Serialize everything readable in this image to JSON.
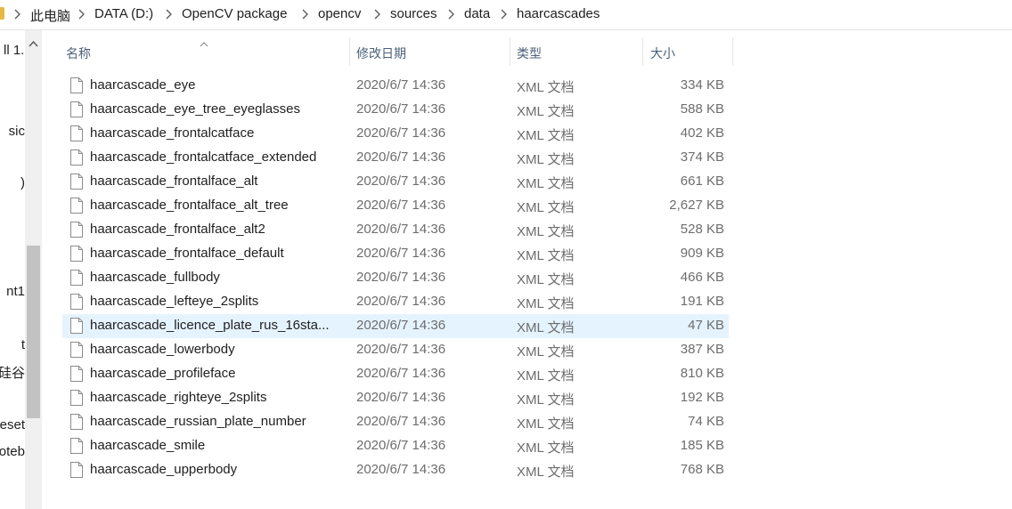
{
  "breadcrumb": [
    "此电脑",
    "DATA (D:)",
    "OpenCV package",
    "opencv",
    "sources",
    "data",
    "haarcascades"
  ],
  "nav_pane_fragments": [
    "ll 1.",
    "sic",
    ")",
    "nt1",
    "t",
    "硅谷",
    "eset",
    "oteb"
  ],
  "columns": {
    "name": "名称",
    "date": "修改日期",
    "type": "类型",
    "size": "大小"
  },
  "files": [
    {
      "name": "haarcascade_eye",
      "date": "2020/6/7 14:36",
      "type": "XML 文档",
      "size": "334 KB"
    },
    {
      "name": "haarcascade_eye_tree_eyeglasses",
      "date": "2020/6/7 14:36",
      "type": "XML 文档",
      "size": "588 KB"
    },
    {
      "name": "haarcascade_frontalcatface",
      "date": "2020/6/7 14:36",
      "type": "XML 文档",
      "size": "402 KB"
    },
    {
      "name": "haarcascade_frontalcatface_extended",
      "date": "2020/6/7 14:36",
      "type": "XML 文档",
      "size": "374 KB"
    },
    {
      "name": "haarcascade_frontalface_alt",
      "date": "2020/6/7 14:36",
      "type": "XML 文档",
      "size": "661 KB"
    },
    {
      "name": "haarcascade_frontalface_alt_tree",
      "date": "2020/6/7 14:36",
      "type": "XML 文档",
      "size": "2,627 KB"
    },
    {
      "name": "haarcascade_frontalface_alt2",
      "date": "2020/6/7 14:36",
      "type": "XML 文档",
      "size": "528 KB"
    },
    {
      "name": "haarcascade_frontalface_default",
      "date": "2020/6/7 14:36",
      "type": "XML 文档",
      "size": "909 KB"
    },
    {
      "name": "haarcascade_fullbody",
      "date": "2020/6/7 14:36",
      "type": "XML 文档",
      "size": "466 KB"
    },
    {
      "name": "haarcascade_lefteye_2splits",
      "date": "2020/6/7 14:36",
      "type": "XML 文档",
      "size": "191 KB"
    },
    {
      "name": "haarcascade_licence_plate_rus_16sta...",
      "date": "2020/6/7 14:36",
      "type": "XML 文档",
      "size": "47 KB"
    },
    {
      "name": "haarcascade_lowerbody",
      "date": "2020/6/7 14:36",
      "type": "XML 文档",
      "size": "387 KB"
    },
    {
      "name": "haarcascade_profileface",
      "date": "2020/6/7 14:36",
      "type": "XML 文档",
      "size": "810 KB"
    },
    {
      "name": "haarcascade_righteye_2splits",
      "date": "2020/6/7 14:36",
      "type": "XML 文档",
      "size": "192 KB"
    },
    {
      "name": "haarcascade_russian_plate_number",
      "date": "2020/6/7 14:36",
      "type": "XML 文档",
      "size": "74 KB"
    },
    {
      "name": "haarcascade_smile",
      "date": "2020/6/7 14:36",
      "type": "XML 文档",
      "size": "185 KB"
    },
    {
      "name": "haarcascade_upperbody",
      "date": "2020/6/7 14:36",
      "type": "XML 文档",
      "size": "768 KB"
    }
  ],
  "selected_row": 10,
  "colors": {
    "selection": "#e5f3ff",
    "header_text": "#4c607a",
    "secondary_text": "#6d6d6d",
    "folder": "#e8b844"
  },
  "icons": {
    "file": "file-icon",
    "breadcrumb_separator": "chevron-right-icon",
    "sort": "sort-ascending-icon",
    "scroll_up": "chevron-up-icon"
  }
}
